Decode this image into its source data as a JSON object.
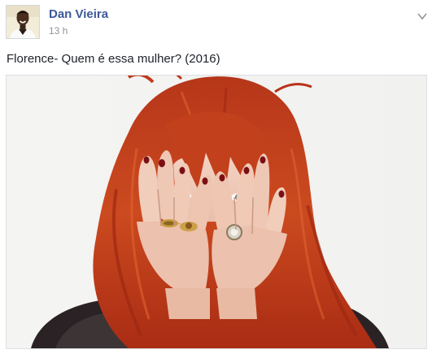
{
  "post": {
    "author": "Dan Vieira",
    "time": "13 h",
    "text": "Florence- Quem é essa mulher? (2016)"
  },
  "icons": {
    "options": "chevron-down-icon"
  },
  "colors": {
    "author_link": "#3b5998",
    "timestamp": "#90949c",
    "body_text": "#1d2129",
    "border": "#dddfe2",
    "hair": "#c8421c"
  }
}
